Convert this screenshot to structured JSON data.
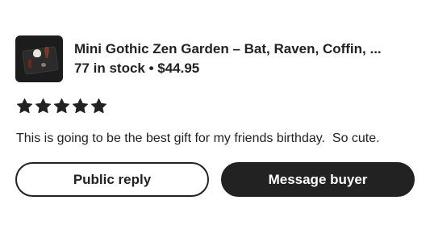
{
  "listing": {
    "title": "Mini Gothic Zen Garden – Bat, Raven, Coffin, ...",
    "stock_price": "77 in stock • $44.95",
    "thumbnail_icon": "gothic-zen-garden-thumbnail"
  },
  "review": {
    "rating": 5,
    "rating_max": 5,
    "star_color": "#222222",
    "text": "This is going to be the best gift for my friends birthday.  So cute."
  },
  "actions": {
    "public_reply_label": "Public reply",
    "message_buyer_label": "Message buyer"
  },
  "colors": {
    "primary": "#222222",
    "background": "#ffffff"
  }
}
